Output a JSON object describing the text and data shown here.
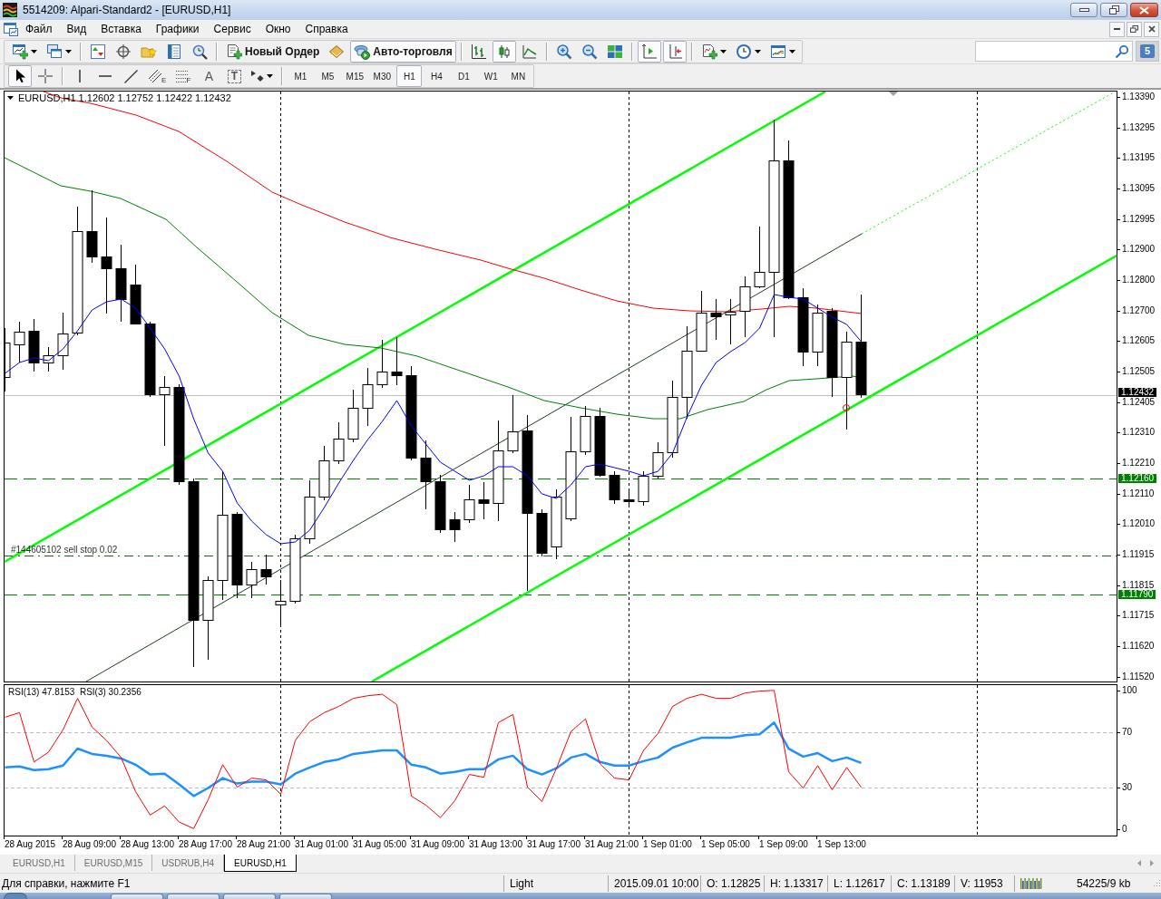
{
  "window": {
    "title": "5514209: Alpari-Standard2 - [EURUSD,H1]"
  },
  "menu": [
    "Файл",
    "Вид",
    "Вставка",
    "Графики",
    "Сервис",
    "Окно",
    "Справка"
  ],
  "toolbar": {
    "groups": [
      [
        {
          "kind": "new-chart",
          "dropdown": true,
          "pressed": false
        },
        {
          "kind": "profiles",
          "dropdown": true,
          "pressed": false
        }
      ],
      [
        {
          "kind": "market-watch",
          "dropdown": false,
          "pressed": false
        },
        {
          "kind": "data-window",
          "dropdown": false,
          "pressed": false
        },
        {
          "kind": "navigator",
          "dropdown": false,
          "pressed": false
        },
        {
          "kind": "terminal",
          "dropdown": false,
          "pressed": false
        },
        {
          "kind": "tester",
          "dropdown": false,
          "pressed": false
        }
      ],
      [
        {
          "kind": "new-order",
          "label": "Новый Ордер",
          "dropdown": false,
          "pressed": false
        },
        {
          "kind": "editor",
          "dropdown": false,
          "pressed": false
        },
        {
          "kind": "auto-trading",
          "label": "Авто-торговля",
          "dropdown": false,
          "pressed": true
        }
      ],
      [
        {
          "kind": "bar-chart",
          "dropdown": false,
          "pressed": false
        },
        {
          "kind": "candlesticks",
          "dropdown": false,
          "pressed": true
        },
        {
          "kind": "line-chart",
          "dropdown": false,
          "pressed": false
        }
      ],
      [
        {
          "kind": "zoom-in",
          "dropdown": false,
          "pressed": false
        },
        {
          "kind": "zoom-out",
          "dropdown": false,
          "pressed": false
        },
        {
          "kind": "tile",
          "dropdown": false,
          "pressed": false
        }
      ],
      [
        {
          "kind": "auto-scroll",
          "dropdown": false,
          "pressed": true
        },
        {
          "kind": "chart-shift",
          "dropdown": false,
          "pressed": true
        }
      ],
      [
        {
          "kind": "indicators",
          "dropdown": true,
          "pressed": false
        },
        {
          "kind": "periods",
          "dropdown": true,
          "pressed": false
        },
        {
          "kind": "templates",
          "dropdown": true,
          "pressed": false
        }
      ]
    ],
    "chat_count": "5"
  },
  "drawing_toolbar": {
    "groups": [
      [
        {
          "kind": "cursor",
          "dropdown": false,
          "pressed": true
        },
        {
          "kind": "crosshair",
          "dropdown": false,
          "pressed": false
        }
      ],
      [
        {
          "kind": "vertical-line",
          "dropdown": false,
          "pressed": false
        },
        {
          "kind": "horizontal-line",
          "dropdown": false,
          "pressed": false
        },
        {
          "kind": "trend-line",
          "dropdown": false,
          "pressed": false
        },
        {
          "kind": "channel",
          "subscript": "E",
          "dropdown": false,
          "pressed": false
        },
        {
          "kind": "fibonacci",
          "subscript": "F",
          "dropdown": false,
          "pressed": false
        },
        {
          "kind": "text",
          "label": "A",
          "dropdown": false,
          "pressed": false
        },
        {
          "kind": "text-label",
          "label": "T",
          "dropdown": false,
          "pressed": false
        },
        {
          "kind": "arrows",
          "dropdown": true,
          "pressed": false
        }
      ]
    ],
    "timeframes": [
      {
        "label": "M1",
        "selected": false
      },
      {
        "label": "M5",
        "selected": false
      },
      {
        "label": "M15",
        "selected": false
      },
      {
        "label": "M30",
        "selected": false
      },
      {
        "label": "H1",
        "selected": true
      },
      {
        "label": "H4",
        "selected": false
      },
      {
        "label": "D1",
        "selected": false
      },
      {
        "label": "W1",
        "selected": false
      },
      {
        "label": "MN",
        "selected": false
      }
    ]
  },
  "chart": {
    "header": "EURUSD,H1 1.12602 1.12752 1.12422 1.12432",
    "price_axis": [
      "1.13390",
      "1.13295",
      "1.13195",
      "1.13095",
      "1.12995",
      "1.12900",
      "1.12800",
      "1.12700",
      "1.12605",
      "1.12505",
      "1.12405",
      "1.12310",
      "1.12210",
      "1.12110",
      "1.12010",
      "1.11915",
      "1.11815",
      "1.11715",
      "1.11620",
      "1.11520"
    ],
    "price_lines": [
      {
        "kind": "bid",
        "tag": "1.12432"
      },
      {
        "kind": "dashed",
        "tag": "1.12160"
      },
      {
        "kind": "dash-dot",
        "label": "#144605102 sell stop 0.02"
      },
      {
        "kind": "dashed",
        "tag": "1.11790"
      }
    ],
    "indicator": {
      "readings": [
        "47.8153",
        "30.2356"
      ],
      "chart_data": {
        "type": "line",
        "grid": true,
        "categories": [
          null,
          null,
          null,
          null,
          null,
          null,
          null,
          null,
          null,
          null,
          null,
          null,
          null,
          null,
          null,
          null,
          null,
          null,
          null,
          null,
          null,
          null,
          null,
          null,
          null,
          null,
          null,
          null,
          null,
          null,
          null,
          null,
          null,
          null,
          null,
          null,
          null,
          null,
          null,
          null,
          null,
          null,
          null,
          null,
          null,
          null,
          null,
          null,
          null,
          null,
          null,
          null,
          null,
          null,
          null,
          null,
          null,
          null,
          null,
          null
        ],
        "series": [
          {
            "name": "RSI(13)",
            "color": "#1e90ff",
            "values": [
              44.5,
              45.2,
              42.6,
              43.2,
              45.8,
              58.1,
              54.2,
              52.9,
              51.0,
              46.5,
              39.4,
              40.0,
              32.3,
              24.0,
              29.7,
              36.8,
              32.9,
              34.2,
              34.2,
              32.3,
              40.0,
              44.5,
              48.4,
              50.3,
              54.2,
              55.5,
              56.8,
              56.8,
              46.5,
              44.5,
              40.0,
              41.3,
              43.2,
              43.2,
              50.3,
              52.9,
              43.2,
              39.4,
              43.9,
              51.6,
              54.2,
              48.4,
              45.8,
              45.8,
              49.0,
              51.6,
              58.7,
              62.6,
              65.8,
              65.8,
              65.8,
              67.7,
              68.4,
              76.8,
              58.0,
              52.3,
              54.8,
              49.0,
              51.6,
              47.8
            ]
          },
          {
            "name": "RSI(3)",
            "color": "#ff0000",
            "values": [
              80.6,
              83.9,
              48.4,
              55.5,
              71.6,
              94.2,
              73.5,
              63.9,
              51.6,
              27.1,
              10.3,
              16.8,
              5.2,
              0.5,
              21.3,
              46.5,
              30.3,
              36.8,
              35.5,
              25.2,
              63.9,
              77.4,
              83.9,
              88.4,
              94.2,
              96.1,
              97.1,
              89.7,
              23.9,
              17.4,
              8.4,
              20.6,
              39.4,
              37.4,
              76.8,
              82.6,
              30.3,
              20.0,
              43.9,
              70.3,
              79.4,
              47.1,
              36.8,
              35.5,
              56.8,
              69.0,
              88.4,
              94.2,
              97.1,
              94.2,
              94.2,
              98.0,
              99.4,
              99.9,
              41.3,
              29.7,
              45.8,
              28.4,
              44.5,
              30.2
            ]
          }
        ],
        "ylim": [
          -4.5,
          103.7
        ],
        "yticks": [
          0,
          30,
          70,
          100
        ]
      }
    },
    "time_axis": [
      "28 Aug 2015",
      "28 Aug 09:00",
      "28 Aug 13:00",
      "28 Aug 17:00",
      "28 Aug 21:00",
      "31 Aug 01:00",
      "31 Aug 05:00",
      "31 Aug 09:00",
      "31 Aug 13:00",
      "31 Aug 17:00",
      "31 Aug 21:00",
      "1 Sep 01:00",
      "1 Sep 05:00",
      "1 Sep 09:00",
      "1 Sep 13:00"
    ]
  },
  "tabs": [
    {
      "label": "EURUSD,H1",
      "selected": false
    },
    {
      "label": "EURUSD,M15",
      "selected": false
    },
    {
      "label": "USDRUB,H4",
      "selected": false
    },
    {
      "label": "EURUSD,H1",
      "selected": true
    }
  ],
  "status_bar": {
    "hint": "Для справки, нажмите F1",
    "profile": "Light",
    "time": "2015.09.01 10:00",
    "open": "O: 1.12825",
    "high": "H: 1.13317",
    "low": "L: 1.12617",
    "close": "C: 1.13189",
    "volume": "V: 11953",
    "traffic": "54225/9 kb"
  }
}
